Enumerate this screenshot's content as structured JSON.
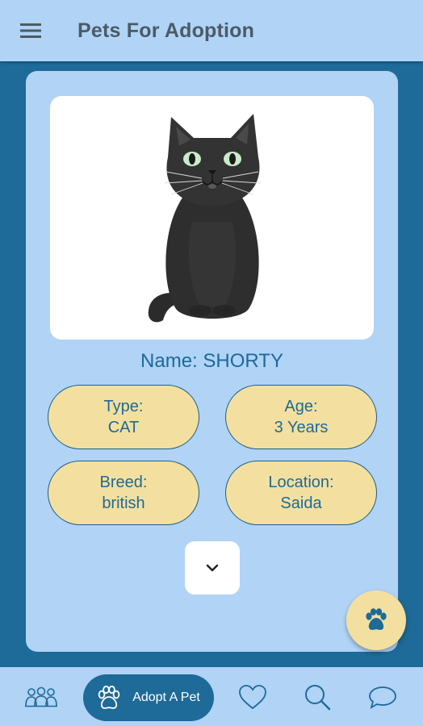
{
  "app_bar": {
    "title": "Pets For Adoption",
    "menu_icon": "hamburger-menu-icon"
  },
  "pet": {
    "name_label": "Name: SHORTY",
    "photo": "black-cat-illustration",
    "details": {
      "type_label": "Type:",
      "type_value": "CAT",
      "age_label": "Age:",
      "age_value": "3 Years",
      "breed_label": "Breed:",
      "breed_value": "british",
      "location_label": "Location:",
      "location_value": "Saida"
    },
    "expand_icon": "chevron-down-icon"
  },
  "fab": {
    "icon": "paw-icon"
  },
  "bottom_nav": {
    "items": [
      {
        "icon": "community-icon"
      },
      {
        "icon": "paw-icon",
        "label": "Adopt A Pet",
        "active": true
      },
      {
        "icon": "heart-icon"
      },
      {
        "icon": "search-icon"
      },
      {
        "icon": "chat-icon"
      }
    ]
  },
  "colors": {
    "background": "#1e6a98",
    "surface": "#b0d3f6",
    "pill": "#f3e0a0",
    "accent": "#1e6a98",
    "title_text": "#4a5b66"
  }
}
